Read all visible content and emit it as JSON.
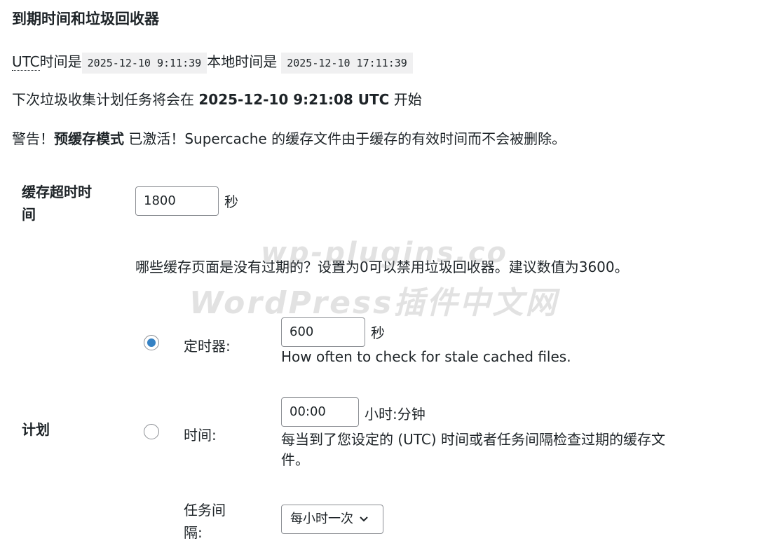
{
  "section": {
    "title": "到期时间和垃圾回收器"
  },
  "time_info": {
    "utc_abbr": "UTC",
    "utc_label": "时间是",
    "utc_value": "2025-12-10 9:11:39",
    "local_label": "本地时间是",
    "local_value": "2025-12-10 17:11:39"
  },
  "next_gc": {
    "prefix": "下次垃圾收集计划任务将会在",
    "datetime": "2025-12-10 9:21:08 UTC",
    "suffix": "开始"
  },
  "warning": {
    "prefix": "警告！",
    "mode": "预缓存模式",
    "suffix": "已激活！Supercache 的缓存文件由于缓存的有效时间而不会被删除。"
  },
  "cache_timeout": {
    "label_line1": "缓存超时时",
    "label_line2": "间",
    "value": "1800",
    "unit": "秒",
    "description": "哪些缓存页面是没有过期的？设置为0可以禁用垃圾回收器。建议数值为3600。"
  },
  "schedule": {
    "label": "计划",
    "timer": {
      "checked": true,
      "label": "定时器:",
      "value": "600",
      "unit": "秒",
      "description": "How often to check for stale cached files."
    },
    "clock": {
      "checked": false,
      "label": "时间:",
      "value": "00:00",
      "unit": "小时:分钟",
      "description_line1": "每当到了您设定的 (UTC) 时间或者任务间隔检查过期的缓存文",
      "description_line2": "件。"
    },
    "interval": {
      "label_line1": "任务间",
      "label_line2": "隔:",
      "selected": "每小时一次"
    }
  },
  "watermark": {
    "line1": "wp-plugins.co",
    "line2": "WordPress插件中文网"
  },
  "colors": {
    "text": "#1d2327",
    "code_bg": "#f0f0f1",
    "border": "#8c8f94",
    "radio_accent": "#3582c4"
  }
}
